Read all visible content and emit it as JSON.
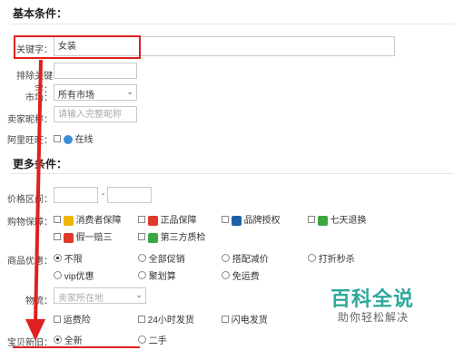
{
  "basic": {
    "title": "基本条件：",
    "keyword_label": "关键字：",
    "keyword_value": "女装",
    "exclude_label": "排除关键字：",
    "market_label": "市场：",
    "market_value": "所有市场",
    "seller_label": "卖家昵称：",
    "seller_placeholder": "请输入完整昵称",
    "wangwang_label": "阿里旺旺：",
    "wangwang_option": "在线"
  },
  "more": {
    "title": "更多条件：",
    "price_label": "价格区间：",
    "price_sep": "-",
    "guarantee_label": "购物保障：",
    "guarantee_options": [
      "消费者保障",
      "正品保障",
      "品牌授权",
      "七天退换",
      "假一赔三",
      "第三方质检"
    ],
    "discount_label": "商品优惠：",
    "discount_options": [
      "不限",
      "全部促销",
      "搭配减价",
      "打折秒杀",
      "vip优惠",
      "聚划算",
      "免运费"
    ],
    "location_label": "物流：",
    "location_placeholder": "卖家所在地",
    "shipping_options": [
      "运费险",
      "24小时发货",
      "闪电发货"
    ],
    "newness_label": "宝贝新旧：",
    "newness_options": [
      "全新",
      "二手"
    ]
  },
  "watermark": {
    "title": "百科全说",
    "subtitle": "助你轻松解决"
  },
  "colors": {
    "highlight": "#e02020",
    "watermark": "#2ea89a"
  }
}
